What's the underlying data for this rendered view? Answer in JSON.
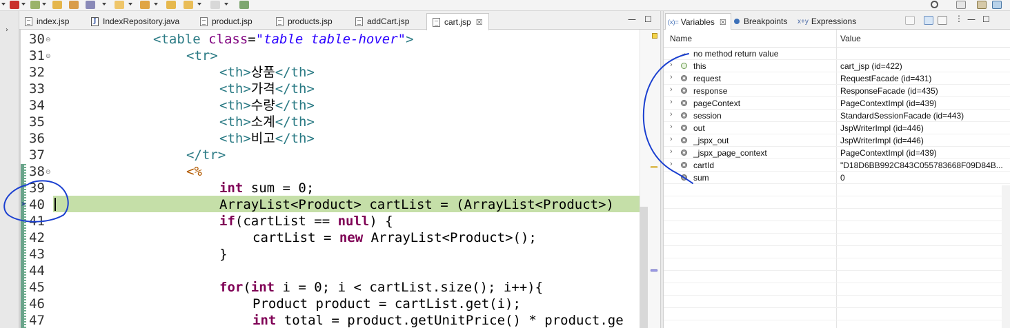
{
  "editor": {
    "tabs": [
      {
        "label": "index.jsp",
        "icon": "jsp-file-icon",
        "active": false
      },
      {
        "label": "IndexRepository.java",
        "icon": "java-file-icon",
        "active": false
      },
      {
        "label": "product.jsp",
        "icon": "jsp-file-icon",
        "active": false
      },
      {
        "label": "products.jsp",
        "icon": "jsp-file-icon",
        "active": false
      },
      {
        "label": "addCart.jsp",
        "icon": "jsp-file-icon",
        "active": false
      },
      {
        "label": "cart.jsp",
        "icon": "jsp-file-icon",
        "active": true,
        "close": "☒"
      }
    ],
    "window_controls": {
      "minimize": "—",
      "maximize": "☐"
    },
    "lines": [
      {
        "num": "30",
        "fold": "⊖"
      },
      {
        "num": "31",
        "fold": "⊖"
      },
      {
        "num": "32"
      },
      {
        "num": "33"
      },
      {
        "num": "34"
      },
      {
        "num": "35"
      },
      {
        "num": "36"
      },
      {
        "num": "37"
      },
      {
        "num": "38",
        "fold": "⊖"
      },
      {
        "num": "39"
      },
      {
        "num": "40",
        "current": true
      },
      {
        "num": "41"
      },
      {
        "num": "42"
      },
      {
        "num": "43"
      },
      {
        "num": "44"
      },
      {
        "num": "45"
      },
      {
        "num": "46"
      },
      {
        "num": "47"
      }
    ],
    "code": {
      "l30": {
        "t1": "<table ",
        "t2": "class",
        "t3": "=",
        "t4": "\"table table-hover\"",
        "t5": ">"
      },
      "l31": {
        "t1": "<tr>"
      },
      "l32": {
        "t1": "<th>",
        "t2": "상품",
        "t3": "</th>"
      },
      "l33": {
        "t1": "<th>",
        "t2": "가격",
        "t3": "</th>"
      },
      "l34": {
        "t1": "<th>",
        "t2": "수량",
        "t3": "</th>"
      },
      "l35": {
        "t1": "<th>",
        "t2": "소계",
        "t3": "</th>"
      },
      "l36": {
        "t1": "<th>",
        "t2": "비고",
        "t3": "</th>"
      },
      "l37": {
        "t1": "</tr>"
      },
      "l38": {
        "t1": "<%"
      },
      "l39": {
        "t1": "int",
        "t2": " sum = 0;"
      },
      "l40": {
        "t1": "ArrayList<Product> cartList = (ArrayList<Product>)"
      },
      "l41": {
        "t1": "if",
        "t2": "(cartList == ",
        "t3": "null",
        "t4": ") {"
      },
      "l42": {
        "t1": "cartList = ",
        "t2": "new",
        "t3": " ArrayList<Product>();"
      },
      "l43": {
        "t1": "}"
      },
      "l44": {
        "t1": ""
      },
      "l45": {
        "t1": "for",
        "t2": "(",
        "t3": "int",
        "t4": " i = 0; i < cartList.size(); i++){"
      },
      "l46": {
        "t1": "Product product = cartList.get(i);"
      },
      "l47": {
        "t1": "int",
        "t2": " total = product.getUnitPrice() * product.ge"
      }
    }
  },
  "variables_panel": {
    "tabs": [
      {
        "label": "Variables",
        "prefix": "(x)=",
        "close": "☒",
        "active": true
      },
      {
        "label": "Breakpoints",
        "icon": "breakpoint-icon"
      },
      {
        "label": "Expressions",
        "icon": "expressions-icon"
      }
    ],
    "columns": {
      "name": "Name",
      "value": "Value"
    },
    "return_row": {
      "icon": "→",
      "name": "no method return value"
    },
    "rows": [
      {
        "name": "this",
        "value": "cart_jsp  (id=422)",
        "kind": "local"
      },
      {
        "name": "request",
        "value": "RequestFacade  (id=431)",
        "kind": "field"
      },
      {
        "name": "response",
        "value": "ResponseFacade  (id=435)",
        "kind": "field"
      },
      {
        "name": "pageContext",
        "value": "PageContextImpl  (id=439)",
        "kind": "field"
      },
      {
        "name": "session",
        "value": "StandardSessionFacade  (id=443)",
        "kind": "field"
      },
      {
        "name": "out",
        "value": "JspWriterImpl  (id=446)",
        "kind": "field"
      },
      {
        "name": "_jspx_out",
        "value": "JspWriterImpl  (id=446)",
        "kind": "field"
      },
      {
        "name": "_jspx_page_context",
        "value": "PageContextImpl  (id=439)",
        "kind": "field"
      },
      {
        "name": "cartId",
        "value": "\"D18D6BB992C843C055783668F09D84B...",
        "kind": "field"
      },
      {
        "name": "sum",
        "value": "0",
        "kind": "field"
      }
    ],
    "window_controls": {
      "minimize": "—",
      "maximize": "☐",
      "menu": "⋮"
    }
  }
}
